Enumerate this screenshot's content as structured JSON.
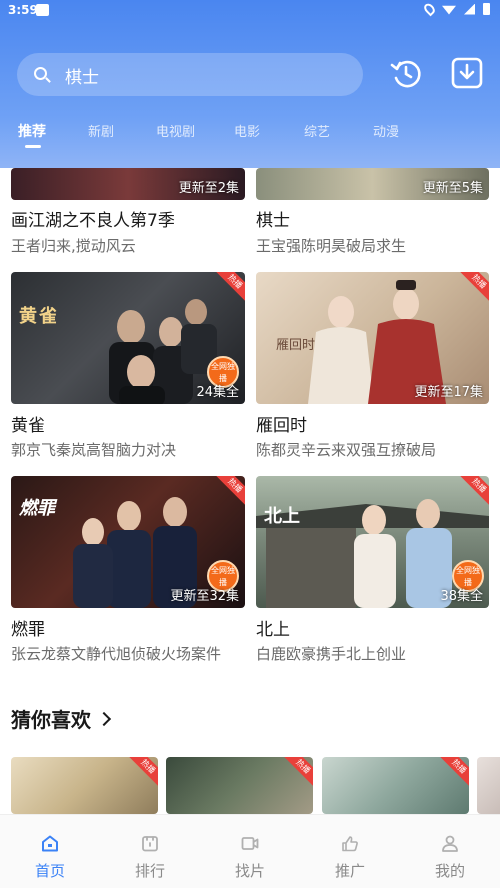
{
  "status_bar": {
    "time": "3:59"
  },
  "search": {
    "value": "棋士"
  },
  "tabs": [
    {
      "label": "推荐",
      "active": true
    },
    {
      "label": "新剧"
    },
    {
      "label": "电视剧"
    },
    {
      "label": "电影"
    },
    {
      "label": "综艺"
    },
    {
      "label": "动漫"
    }
  ],
  "hot_tag": "热播",
  "exclusive_badge": "全网独播",
  "cards": [
    {
      "title": "画江湖之不良人第7季",
      "subtitle": "王者归来,搅动风云",
      "episode": "更新至2集"
    },
    {
      "title": "棋士",
      "subtitle": "王宝强陈明昊破局求生",
      "episode": "更新至5集"
    },
    {
      "title": "黄雀",
      "subtitle": "郭京飞秦岚高智脑力对决",
      "episode": "24集全",
      "poster_text": "黄雀",
      "exclusive": true
    },
    {
      "title": "雁回时",
      "subtitle": "陈都灵辛云来双强互撩破局",
      "episode": "更新至17集",
      "poster_text": "雁回时"
    },
    {
      "title": "燃罪",
      "subtitle": "张云龙蔡文静代旭侦破火场案件",
      "episode": "更新至32集",
      "poster_text": "燃罪",
      "exclusive": true
    },
    {
      "title": "北上",
      "subtitle": "白鹿欧豪携手北上创业",
      "episode": "38集全",
      "poster_text": "北上",
      "exclusive": true
    }
  ],
  "section": {
    "title": "猜你喜欢"
  },
  "bottom_nav": [
    {
      "label": "首页",
      "icon": "home-icon",
      "active": true
    },
    {
      "label": "排行",
      "icon": "ranking-icon"
    },
    {
      "label": "找片",
      "icon": "find-video-icon"
    },
    {
      "label": "推广",
      "icon": "promote-icon"
    },
    {
      "label": "我的",
      "icon": "profile-icon"
    }
  ],
  "colors": {
    "header": "#4a86f0",
    "active_nav": "#3b82f6",
    "hot_tag": "#e8403a",
    "exclusive": "#f36a1a"
  }
}
